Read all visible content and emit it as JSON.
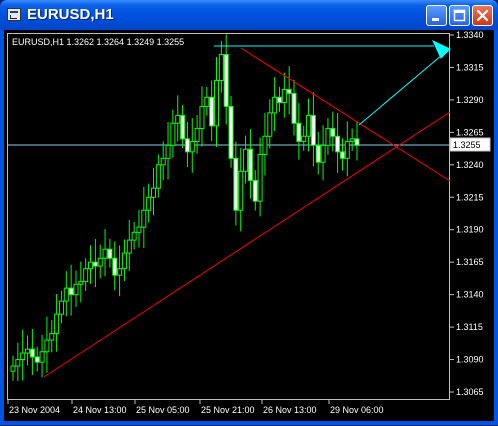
{
  "window": {
    "title": "EURUSD,H1",
    "icon": "chart-window-icon",
    "buttons": [
      "minimize-icon",
      "maximize-icon",
      "close-icon"
    ]
  },
  "chart": {
    "info_text": "EURUSD,H1  1.3262 1.3264 1.3249 1.3255",
    "current_price_label": "1.3255",
    "colors": {
      "background": "#000000",
      "candle": "#00ff00",
      "trendline": "#ff0000",
      "arrow": "#00ffff",
      "price_line": "#87ceeb"
    }
  },
  "chart_data": {
    "type": "candlestick",
    "symbol": "EURUSD",
    "timeframe": "H1",
    "ohlc_last": {
      "open": 1.3262,
      "high": 1.3264,
      "low": 1.3249,
      "close": 1.3255
    },
    "ylim": [
      1.3065,
      1.334
    ],
    "y_ticks": [
      "1.3340",
      "1.3315",
      "1.3290",
      "1.3265",
      "1.3240",
      "1.3215",
      "1.3190",
      "1.3165",
      "1.3140",
      "1.3115",
      "1.3090",
      "1.3065"
    ],
    "x_ticks": [
      "23 Nov 2004",
      "24 Nov 13:00",
      "25 Nov 05:00",
      "25 Nov 21:00",
      "26 Nov 13:00",
      "29 Nov 06:00"
    ],
    "current_price": 1.3255,
    "series_close_approx": [
      1.3085,
      1.309,
      1.3095,
      1.3098,
      1.3092,
      1.3088,
      1.3096,
      1.3105,
      1.311,
      1.3125,
      1.3135,
      1.3145,
      1.314,
      1.3148,
      1.315,
      1.316,
      1.3165,
      1.3162,
      1.3168,
      1.3175,
      1.3168,
      1.3155,
      1.316,
      1.3172,
      1.3182,
      1.3188,
      1.3192,
      1.3205,
      1.3215,
      1.3222,
      1.324,
      1.3245,
      1.3255,
      1.3272,
      1.3278,
      1.326,
      1.325,
      1.3258,
      1.3268,
      1.3285,
      1.3292,
      1.327,
      1.3305,
      1.3325,
      1.3285,
      1.3245,
      1.3205,
      1.3235,
      1.3252,
      1.3228,
      1.3212,
      1.3248,
      1.3262,
      1.328,
      1.3292,
      1.3288,
      1.3298,
      1.3295,
      1.3272,
      1.3258,
      1.3262,
      1.3278,
      1.3255,
      1.3242,
      1.3255,
      1.3268,
      1.3262,
      1.325,
      1.3245,
      1.3258,
      1.326,
      1.3255
    ]
  }
}
